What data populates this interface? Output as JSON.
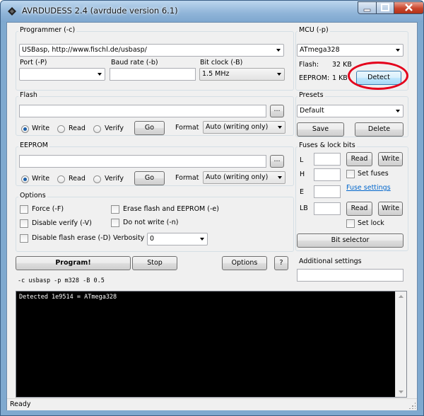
{
  "window": {
    "title": "AVRDUDESS 2.4 (avrdude version 6.1)"
  },
  "programmer": {
    "legend": "Programmer (-c)",
    "selected": "USBasp, http://www.fischl.de/usbasp/",
    "port_label": "Port (-P)",
    "port_value": "",
    "baud_label": "Baud rate (-b)",
    "baud_value": "",
    "bitclock_label": "Bit clock (-B)",
    "bitclock_value": "1.5 MHz"
  },
  "mcu": {
    "legend": "MCU (-p)",
    "selected": "ATmega328",
    "flash_label": "Flash:",
    "flash_value": "32 KB",
    "eeprom_label": "EEPROM:",
    "eeprom_value": "1 KB",
    "detect_label": "Detect"
  },
  "flash": {
    "legend": "Flash",
    "file": "",
    "browse_label": "...",
    "write_label": "Write",
    "read_label": "Read",
    "verify_label": "Verify",
    "go_label": "Go",
    "format_label": "Format",
    "format_value": "Auto (writing only)"
  },
  "eeprom": {
    "legend": "EEPROM",
    "file": "",
    "browse_label": "...",
    "write_label": "Write",
    "read_label": "Read",
    "verify_label": "Verify",
    "go_label": "Go",
    "format_label": "Format",
    "format_value": "Auto (writing only)"
  },
  "presets": {
    "legend": "Presets",
    "selected": "Default",
    "save_label": "Save",
    "delete_label": "Delete"
  },
  "fuses": {
    "legend": "Fuses & lock bits",
    "l_label": "L",
    "h_label": "H",
    "e_label": "E",
    "lb_label": "LB",
    "read_label": "Read",
    "write_label": "Write",
    "set_fuses_label": "Set fuses",
    "fuse_settings_link": "Fuse settings",
    "set_lock_label": "Set lock",
    "bit_selector_label": "Bit selector"
  },
  "options": {
    "legend": "Options",
    "force_label": "Force (-F)",
    "erase_label": "Erase flash and EEPROM (-e)",
    "disable_verify_label": "Disable verify (-V)",
    "no_write_label": "Do not write (-n)",
    "disable_flash_erase_label": "Disable flash erase (-D)",
    "verbosity_label": "Verbosity",
    "verbosity_value": "0"
  },
  "actions": {
    "program_label": "Program!",
    "stop_label": "Stop",
    "options_label": "Options",
    "help_label": "?"
  },
  "additional": {
    "legend": "Additional settings",
    "value": ""
  },
  "cmdline": "-c usbasp -p m328 -B 0.5",
  "console": "Detected 1e9514 = ATmega328",
  "status": "Ready"
}
